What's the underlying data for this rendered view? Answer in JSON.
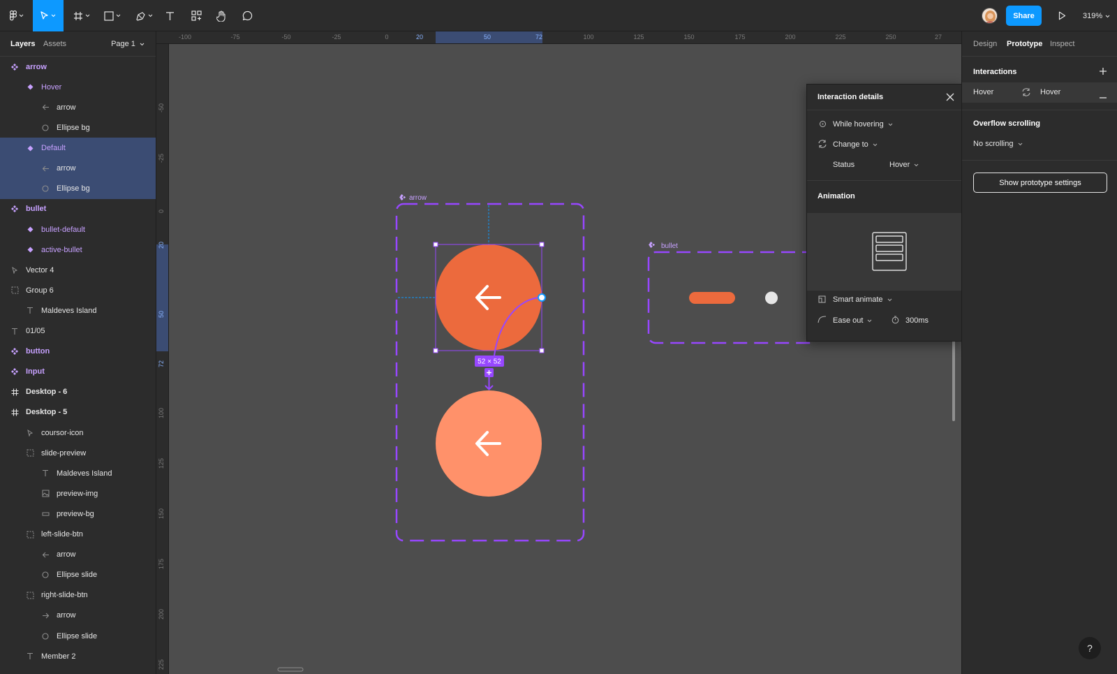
{
  "toolbar": {
    "share_label": "Share",
    "zoom_label": "319%"
  },
  "left_panel": {
    "tabs": [
      "Layers",
      "Assets"
    ],
    "page_selector": "Page 1",
    "layers": [
      {
        "label": "arrow",
        "type": "component-set",
        "indent": 0
      },
      {
        "label": "Hover",
        "type": "variant",
        "indent": 1
      },
      {
        "label": "arrow",
        "type": "arrow-left",
        "indent": 2
      },
      {
        "label": "Ellipse bg",
        "type": "ellipse",
        "indent": 2
      },
      {
        "label": "Default",
        "type": "variant",
        "indent": 1,
        "selected": true
      },
      {
        "label": "arrow",
        "type": "arrow-left",
        "indent": 2,
        "selected": true
      },
      {
        "label": "Ellipse bg",
        "type": "ellipse",
        "indent": 2,
        "selected": true
      },
      {
        "label": "bullet",
        "type": "component-set",
        "indent": 0
      },
      {
        "label": "bullet-default",
        "type": "variant",
        "indent": 1
      },
      {
        "label": "active-bullet",
        "type": "variant",
        "indent": 1
      },
      {
        "label": "Vector 4",
        "type": "vector",
        "indent": 0
      },
      {
        "label": "Group 6",
        "type": "group",
        "indent": 0
      },
      {
        "label": "Maldeves Island",
        "type": "text",
        "indent": 1
      },
      {
        "label": "01/05",
        "type": "text",
        "indent": 0
      },
      {
        "label": "button",
        "type": "component-set",
        "indent": 0
      },
      {
        "label": "Input",
        "type": "component-set",
        "indent": 0
      },
      {
        "label": "Desktop - 6",
        "type": "frame",
        "indent": 0
      },
      {
        "label": "Desktop - 5",
        "type": "frame",
        "indent": 0
      },
      {
        "label": "coursor-icon",
        "type": "vector",
        "indent": 1
      },
      {
        "label": "slide-preview",
        "type": "group",
        "indent": 1
      },
      {
        "label": "Maldeves Island",
        "type": "text",
        "indent": 2
      },
      {
        "label": "preview-img",
        "type": "image",
        "indent": 2
      },
      {
        "label": "preview-bg",
        "type": "rect",
        "indent": 2
      },
      {
        "label": "left-slide-btn",
        "type": "group",
        "indent": 1
      },
      {
        "label": "arrow",
        "type": "arrow-left",
        "indent": 2
      },
      {
        "label": "Ellipse slide",
        "type": "ellipse",
        "indent": 2
      },
      {
        "label": "right-slide-btn",
        "type": "group",
        "indent": 1
      },
      {
        "label": "arrow",
        "type": "arrow-right",
        "indent": 2
      },
      {
        "label": "Ellipse slide",
        "type": "ellipse",
        "indent": 2
      },
      {
        "label": "Member 2",
        "type": "text",
        "indent": 1
      }
    ]
  },
  "rulers": {
    "top": [
      "-100",
      "-75",
      "-50",
      "-25",
      "0",
      "20",
      "50",
      "72",
      "100",
      "125",
      "150",
      "175",
      "200",
      "225",
      "250",
      "27"
    ],
    "left": [
      "-50",
      "-25",
      "0",
      "20",
      "50",
      "72",
      "100",
      "125",
      "150",
      "175",
      "200",
      "225"
    ]
  },
  "canvas": {
    "frame_arrow_label": "arrow",
    "frame_bullet_label": "bullet",
    "selection_size": "52 × 52",
    "accent_orange": "#ec6a3d",
    "accent_orange_light": "#ff916a",
    "accent_purple": "#9747ff"
  },
  "right_panel": {
    "tabs": [
      "Design",
      "Prototype",
      "Inspect"
    ],
    "interactions_title": "Interactions",
    "interaction_trigger": "Hover",
    "interaction_target": "Hover",
    "overflow_title": "Overflow scrolling",
    "overflow_value": "No scrolling",
    "prototype_settings_button": "Show prototype settings"
  },
  "popover": {
    "title": "Interaction details",
    "trigger": "While hovering",
    "action": "Change to",
    "property_label": "Status",
    "property_value": "Hover",
    "animation_title": "Animation",
    "animation_type": "Smart animate",
    "easing": "Ease out",
    "duration": "300ms"
  },
  "help_label": "?"
}
